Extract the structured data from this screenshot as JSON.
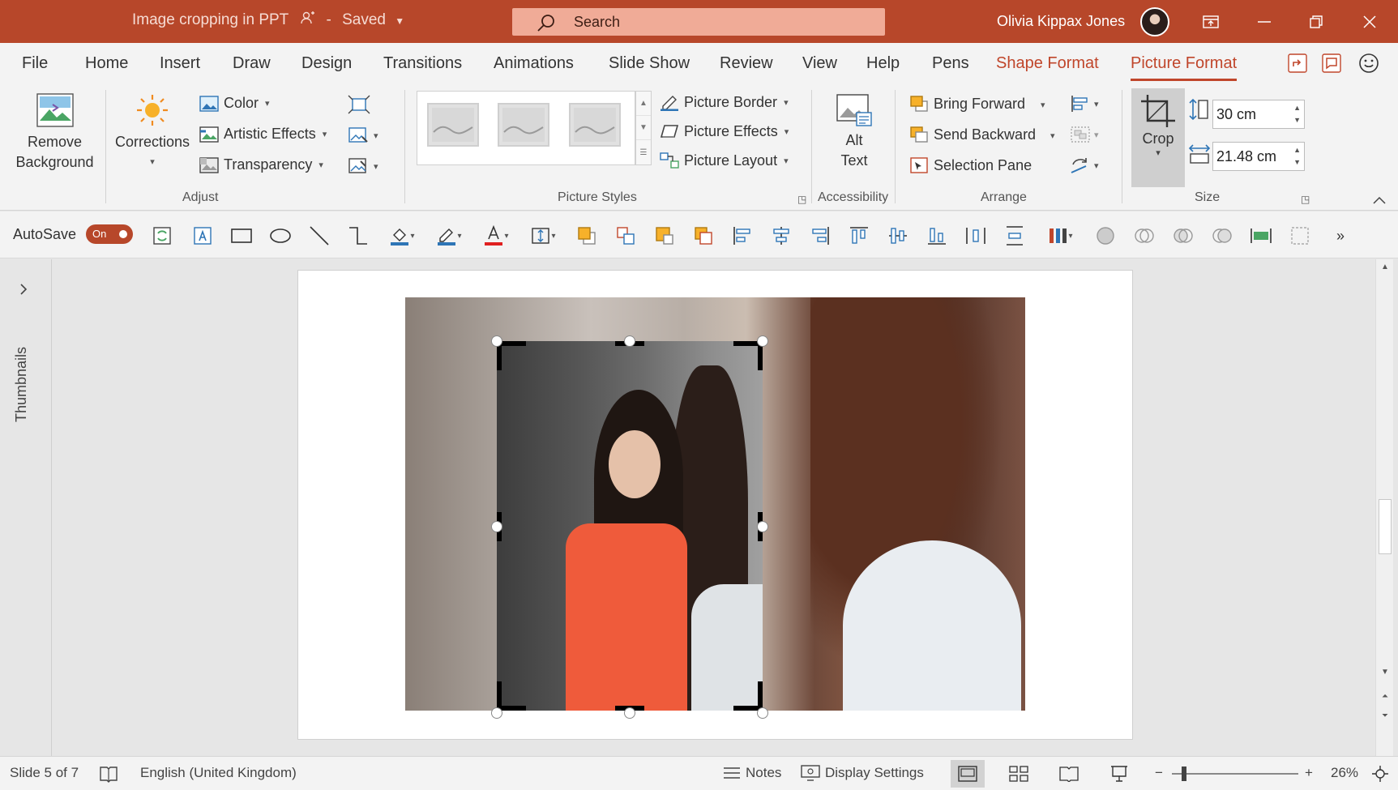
{
  "titlebar": {
    "document_title": "Image cropping in PPT",
    "save_state": "Saved",
    "search_placeholder": "Search",
    "user_name": "Olivia Kippax Jones"
  },
  "tabs": [
    {
      "label": "File"
    },
    {
      "label": "Home"
    },
    {
      "label": "Insert"
    },
    {
      "label": "Draw"
    },
    {
      "label": "Design"
    },
    {
      "label": "Transitions"
    },
    {
      "label": "Animations"
    },
    {
      "label": "Slide Show"
    },
    {
      "label": "Review"
    },
    {
      "label": "View"
    },
    {
      "label": "Help"
    },
    {
      "label": "Pens"
    },
    {
      "label": "Shape Format"
    },
    {
      "label": "Picture Format"
    }
  ],
  "active_tab": "Picture Format",
  "ribbon": {
    "adjust": {
      "remove_background_line1": "Remove",
      "remove_background_line2": "Background",
      "corrections": "Corrections",
      "color": "Color",
      "artistic_effects": "Artistic Effects",
      "transparency": "Transparency",
      "label": "Adjust"
    },
    "picture_styles": {
      "picture_border": "Picture Border",
      "picture_effects": "Picture Effects",
      "picture_layout": "Picture Layout",
      "label": "Picture Styles"
    },
    "accessibility": {
      "alt_text_line1": "Alt",
      "alt_text_line2": "Text",
      "label": "Accessibility"
    },
    "arrange": {
      "bring_forward": "Bring Forward",
      "send_backward": "Send Backward",
      "selection_pane": "Selection Pane",
      "label": "Arrange"
    },
    "size": {
      "crop": "Crop",
      "height": "30 cm",
      "width": "21.48 cm",
      "label": "Size"
    }
  },
  "qat": {
    "autosave_label": "AutoSave",
    "autosave_state": "On"
  },
  "thumbnails_label": "Thumbnails",
  "statusbar": {
    "slide_info": "Slide 5 of 7",
    "language": "English (United Kingdom)",
    "notes": "Notes",
    "display_settings": "Display Settings",
    "zoom": "26%",
    "zoom_minus": "−",
    "zoom_plus": "+"
  },
  "colors": {
    "accent": "#b7472a",
    "contextual_tab": "#c0462b"
  }
}
